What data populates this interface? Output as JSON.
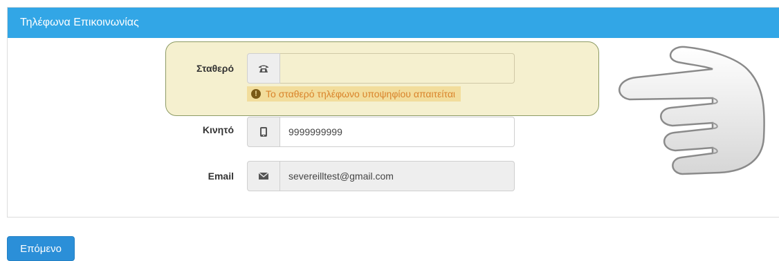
{
  "panel": {
    "title": "Τηλέφωνα Επικοινωνίας"
  },
  "fields": {
    "landline": {
      "label": "Σταθερό",
      "value": "",
      "icon": "phone-icon",
      "error": "Το σταθερό τηλέφωνο υποψηφίου απαιτείται",
      "error_icon": "exclamation-icon"
    },
    "mobile": {
      "label": "Κινητό",
      "value": "9999999999",
      "icon": "mobile-icon"
    },
    "email": {
      "label": "Email",
      "value": "severeilltest@gmail.com",
      "icon": "envelope-icon"
    }
  },
  "actions": {
    "next_label": "Επόμενο"
  },
  "colors": {
    "header": "#32a6e6",
    "highlight": "#f5f0cf",
    "error_text": "#d9832a",
    "button": "#2b8fd8"
  }
}
